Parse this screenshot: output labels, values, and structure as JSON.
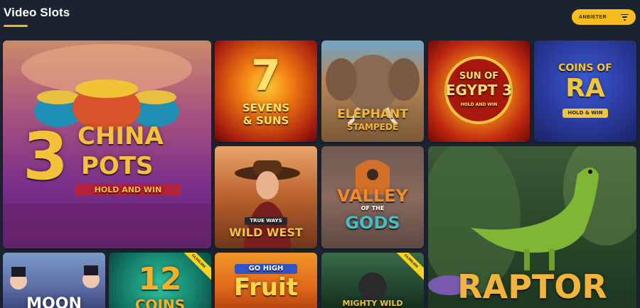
{
  "header": {
    "title": "Video Slots",
    "filter_label": "ANBIETER"
  },
  "colors": {
    "background": "#1b2230",
    "accent": "#f7bd1e"
  },
  "games": [
    {
      "id": "china-pots",
      "big_label": "3",
      "line1": "CHINA",
      "line2": "POTS",
      "line3": "HOLD AND WIN"
    },
    {
      "id": "sevens-suns",
      "big_label": "7",
      "line1": "SEVENS",
      "line2": "& SUNS"
    },
    {
      "id": "elephant",
      "line1": "ELEPHANT",
      "line2": "STAMPEDE"
    },
    {
      "id": "sun-egypt",
      "line1": "SUN OF",
      "line2": "EGYPT 3",
      "line3": "HOLD AND WIN"
    },
    {
      "id": "coins-ra",
      "line1": "COINS OF",
      "line2": "RA",
      "line3": "HOLD & WIN"
    },
    {
      "id": "wild-west",
      "line1": "TRUE WAYS",
      "line2": "WILD WEST"
    },
    {
      "id": "valley-gods",
      "line1": "VALLEY",
      "line2": "OF THE",
      "line3": "GODS"
    },
    {
      "id": "raptor",
      "line1": "RAPTOR"
    },
    {
      "id": "moon",
      "line1": "MOON"
    },
    {
      "id": "coins-12",
      "big_label": "12",
      "line1": "COINS",
      "badge": "€4,000,000"
    },
    {
      "id": "go-high-fruit",
      "line1": "GO HIGH",
      "line2": "Fruit"
    },
    {
      "id": "mighty-wild",
      "line1": "MIGHTY WILD",
      "badge": "€4,000,000"
    }
  ]
}
